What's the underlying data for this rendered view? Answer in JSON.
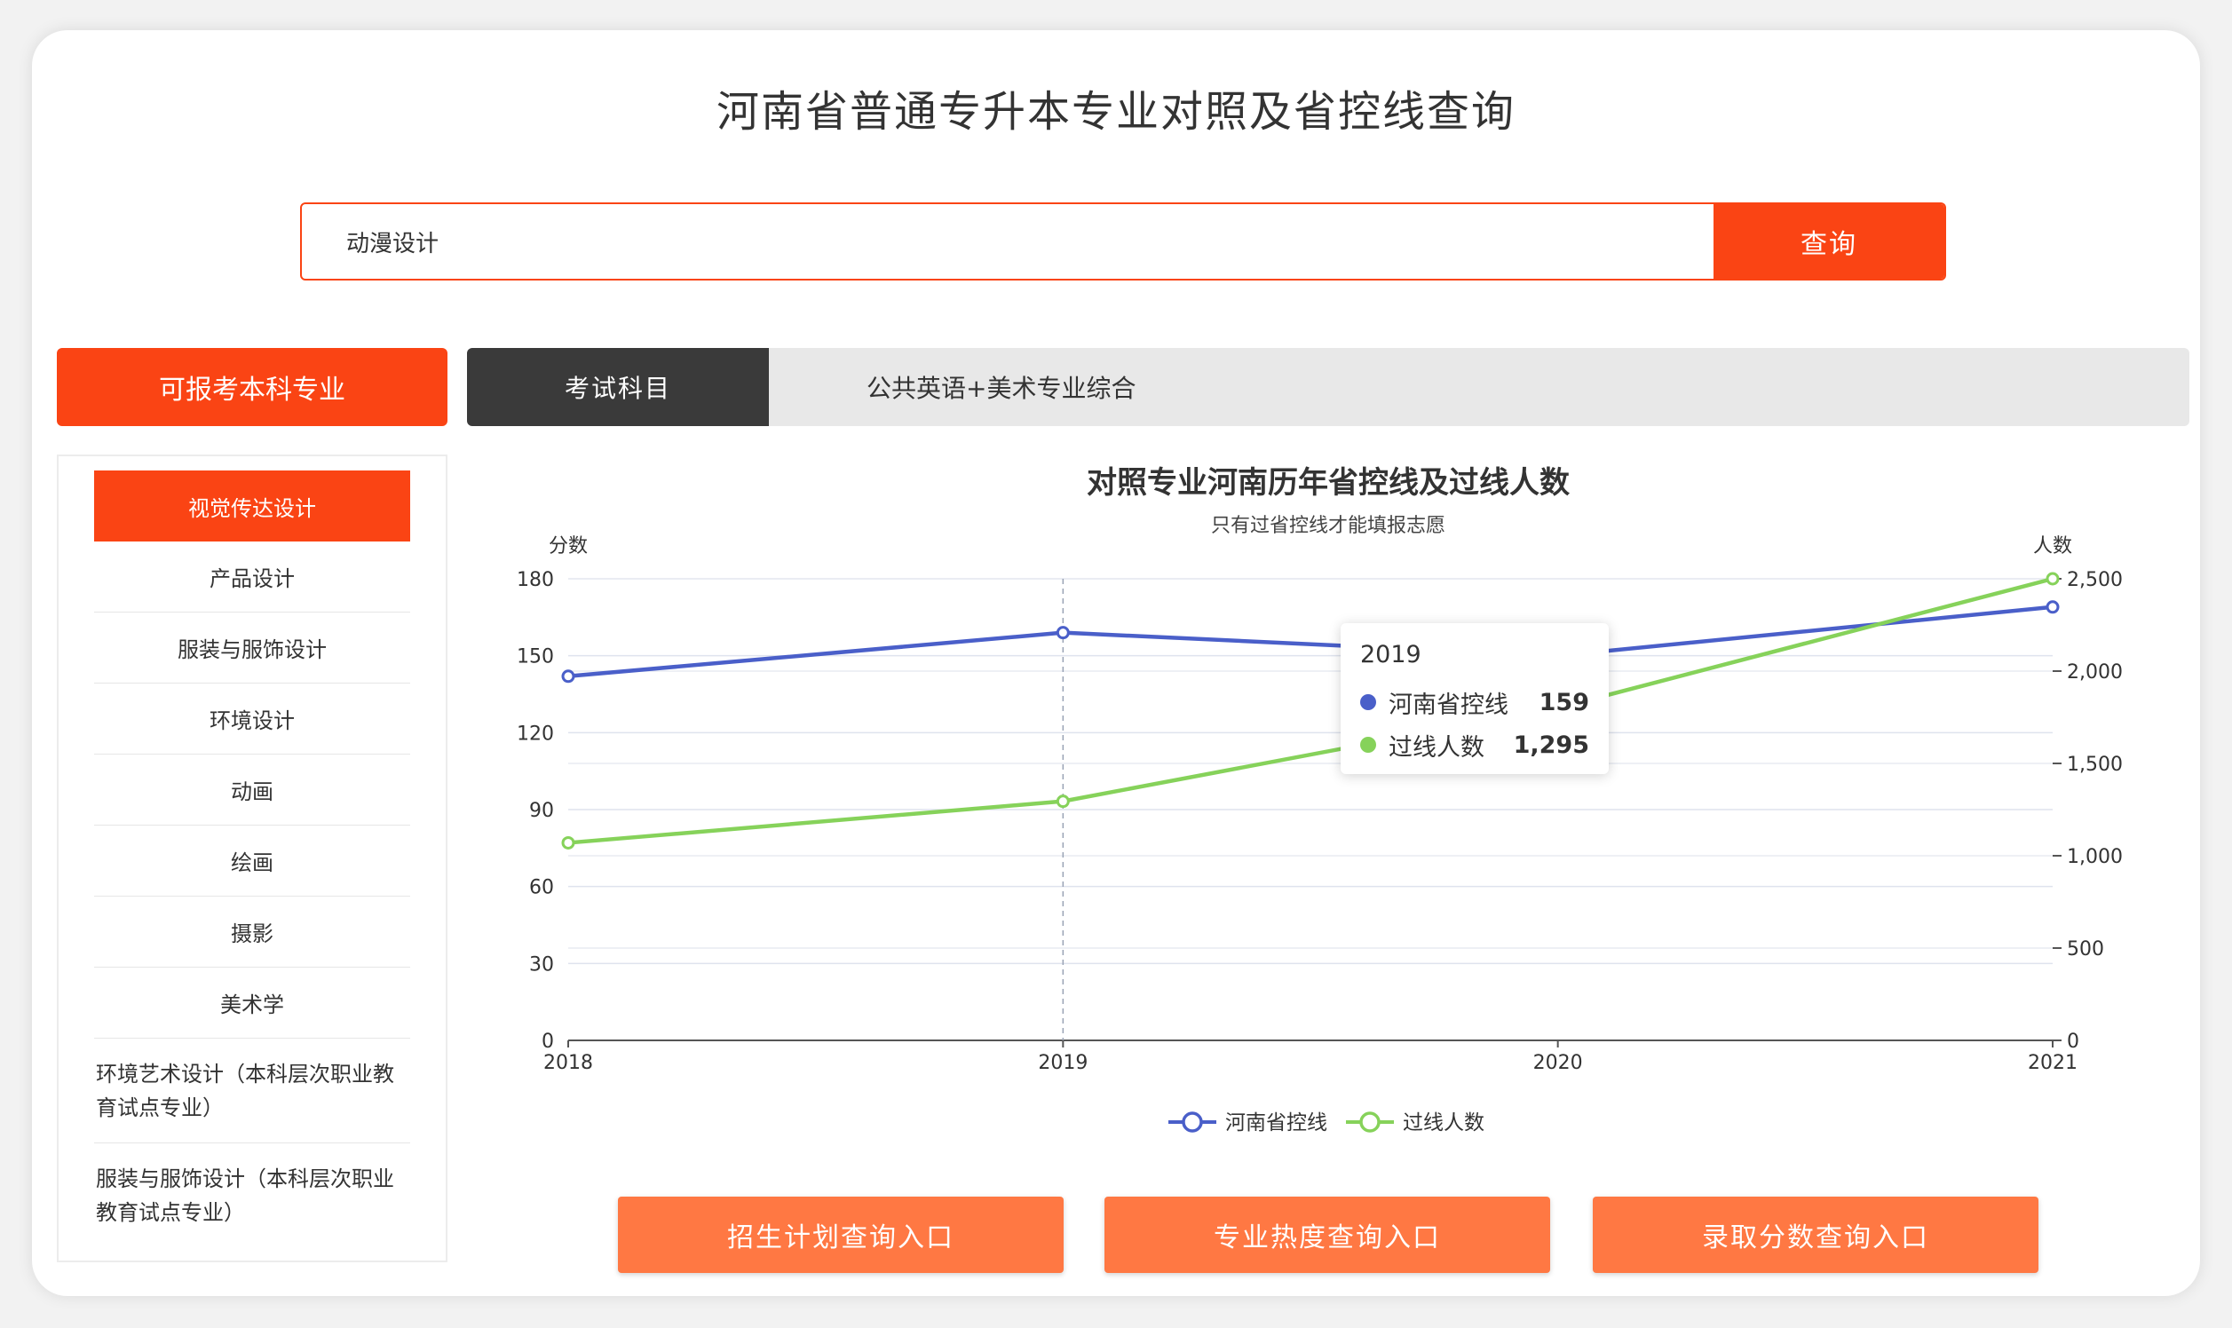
{
  "page": {
    "title": "河南省普通专升本专业对照及省控线查询"
  },
  "search": {
    "value": "动漫设计",
    "button_label": "查询"
  },
  "left_panel": {
    "heading": "可报考本科专业",
    "majors": [
      "视觉传达设计",
      "产品设计",
      "服装与服饰设计",
      "环境设计",
      "动画",
      "绘画",
      "摄影",
      "美术学",
      "环境艺术设计（本科层次职业教育试点专业）",
      "服装与服饰设计（本科层次职业教育试点专业）"
    ],
    "selected_index": 0
  },
  "exam": {
    "tab_label": "考试科目",
    "subjects": "公共英语+美术专业综合"
  },
  "colors": {
    "accent": "#fa4414",
    "button": "#ff7843",
    "line_score": "#4a5fc9",
    "line_count": "#86d25a"
  },
  "chart_data": {
    "type": "line",
    "title": "对照专业河南历年省控线及过线人数",
    "subtitle": "只有过省控线才能填报志愿",
    "x": [
      "2018",
      "2019",
      "2020",
      "2021"
    ],
    "y_left": {
      "label": "分数",
      "range": [
        0,
        180
      ],
      "ticks": [
        0,
        30,
        60,
        90,
        120,
        150,
        180
      ]
    },
    "y_right": {
      "label": "人数",
      "range": [
        0,
        2500
      ],
      "ticks": [
        "0",
        "500",
        "1,000",
        "1,500",
        "2,000",
        "2,500"
      ],
      "tick_values": [
        0,
        500,
        1000,
        1500,
        2000,
        2500
      ]
    },
    "series": [
      {
        "name": "河南省控线",
        "axis": "left",
        "color": "#4a5fc9",
        "values": [
          142,
          159,
          150,
          169
        ]
      },
      {
        "name": "过线人数",
        "axis": "right",
        "color": "#86d25a",
        "values": [
          1070,
          1295,
          1800,
          2500
        ]
      }
    ],
    "legend": "bottom-center",
    "grid": true,
    "tooltip": {
      "year": "2019",
      "rows": [
        {
          "name": "河南省控线",
          "value": "159"
        },
        {
          "name": "过线人数",
          "value": "1,295"
        }
      ]
    }
  },
  "actions": {
    "enroll_plan": "招生计划查询入口",
    "major_heat": "专业热度查询入口",
    "admit_score": "录取分数查询入口"
  }
}
